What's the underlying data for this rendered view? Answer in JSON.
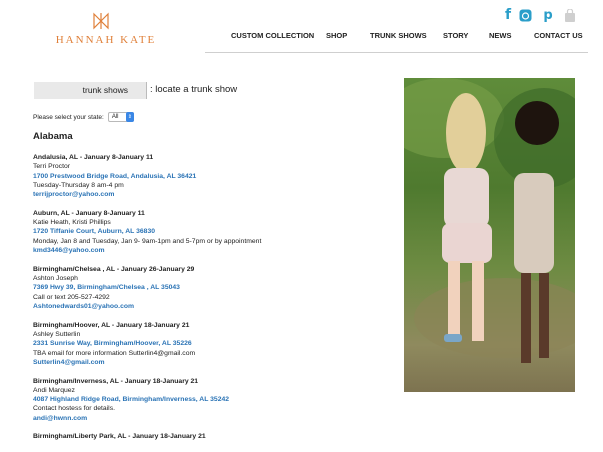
{
  "brand": {
    "name": "HANNAH KATE",
    "color": "#e0803a"
  },
  "social": [
    {
      "icon": "facebook-icon",
      "glyph": "f",
      "color": "#2a9ec9"
    },
    {
      "icon": "instagram-icon",
      "glyph": "◙",
      "color": "#2a9ec9"
    },
    {
      "icon": "pinterest-icon",
      "glyph": "p",
      "color": "#2a9ec9"
    },
    {
      "icon": "shopping-bag-icon",
      "glyph": "",
      "color": "#cfcfcf"
    }
  ],
  "nav": [
    "CUSTOM COLLECTION",
    "SHOP",
    "TRUNK SHOWS",
    "STORY",
    "NEWS",
    "CONTACT US"
  ],
  "section": {
    "tag": "trunk shows",
    "subtitle": ": locate a trunk show"
  },
  "state_filter": {
    "label": "Please select your state:",
    "value": "All"
  },
  "state_heading": "Alabama",
  "entries": [
    {
      "title": "Andalusia, AL - January 8-January 11",
      "lines": [
        "Terri Proctor"
      ],
      "address": "1700 Prestwood Bridge Road, Andalusia, AL 36421",
      "notes": [
        "Tuesday-Thursday 8 am-4 pm"
      ],
      "email": "terrijproctor@yahoo.com"
    },
    {
      "title": "Auburn, AL - January 8-January 11",
      "lines": [
        "Katie Heath, Kristi Phillips"
      ],
      "address": "1720 Tiffanie Court, Auburn, AL 36830",
      "notes": [
        "Monday, Jan 8 and Tuesday, Jan 9- 9am-1pm and 5-7pm or by appointment"
      ],
      "email": "kmd3446@yahoo.com"
    },
    {
      "title": "Birmingham/Chelsea , AL - January 26-January 29",
      "lines": [
        "Ashton Joseph"
      ],
      "address": "7369 Hwy 39, Birmingham/Chelsea , AL 35043",
      "notes": [
        "Call or text 205-527-4292"
      ],
      "email": "Ashtonedwards01@yahoo.com"
    },
    {
      "title": "Birmingham/Hoover, AL - January 18-January 21",
      "lines": [
        "Ashley Sutterlin"
      ],
      "address": "2331 Sunrise Way, Birmingham/Hoover, AL 35226",
      "notes": [
        "TBA email for more information Sutterlin4@gmail.com"
      ],
      "email": "Sutterlin4@gmail.com"
    },
    {
      "title": "Birmingham/Inverness, AL - January 18-January 21",
      "lines": [
        "Andi Marquez"
      ],
      "address": "4087 Highland Ridge Road, Birmingham/Inverness, AL 35242",
      "notes": [
        "Contact hostess for details."
      ],
      "email": "andi@hwnn.com"
    },
    {
      "title": "Birmingham/Liberty Park, AL - January 18-January 21",
      "lines": [],
      "address": "",
      "notes": [],
      "email": ""
    }
  ]
}
